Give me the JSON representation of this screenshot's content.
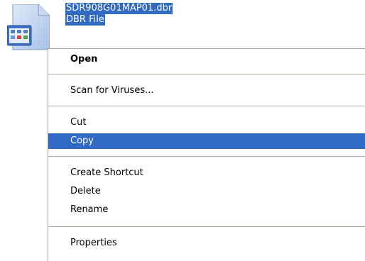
{
  "file": {
    "name": "SDR908G01MAP01.dbr",
    "type": "DBR File",
    "icon": "generic-document-icon"
  },
  "context_menu": {
    "items": [
      {
        "label": "Open",
        "bold": true,
        "selected": false
      },
      {
        "label": "Scan for Viruses...",
        "bold": false,
        "selected": false
      },
      {
        "label": "Cut",
        "bold": false,
        "selected": false
      },
      {
        "label": "Copy",
        "bold": false,
        "selected": true
      },
      {
        "label": "Create Shortcut",
        "bold": false,
        "selected": false
      },
      {
        "label": "Delete",
        "bold": false,
        "selected": false
      },
      {
        "label": "Rename",
        "bold": false,
        "selected": false
      },
      {
        "label": "Properties",
        "bold": false,
        "selected": false
      }
    ]
  },
  "colors": {
    "selection": "#316ac5",
    "separator": "#aca899",
    "menu_background": "#ffffff"
  }
}
